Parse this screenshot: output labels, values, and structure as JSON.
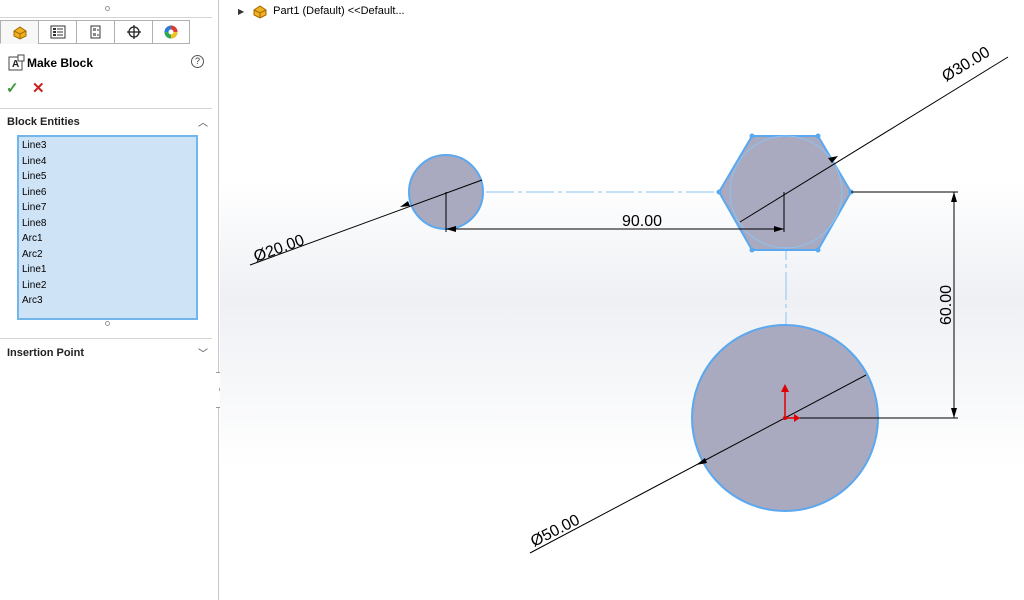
{
  "panel": {
    "title": "Make Block",
    "help": "?",
    "ok": "✓",
    "cancel": "✕",
    "block_entities": {
      "title": "Block Entities",
      "items": [
        "Line3",
        "Line4",
        "Line5",
        "Line6",
        "Line7",
        "Line8",
        "Arc1",
        "Arc2",
        "Line1",
        "Line2",
        "Arc3"
      ]
    },
    "insertion_point": {
      "title": "Insertion Point"
    },
    "colors": {
      "list_bg": "#cfe3f7",
      "list_border": "#72b6ec"
    }
  },
  "breadcrumb": {
    "text": "Part1 (Default) <<Default..."
  },
  "sketch": {
    "dimensions": {
      "d20": "Ø20.00",
      "d30": "Ø30.00",
      "d50": "Ø50.00",
      "h90": "90.00",
      "v60": "60.00"
    },
    "colors": {
      "fill": "#a9a9bf",
      "edge": "#5aa8f0",
      "dim": "#000000",
      "origin": "#e00000"
    }
  }
}
